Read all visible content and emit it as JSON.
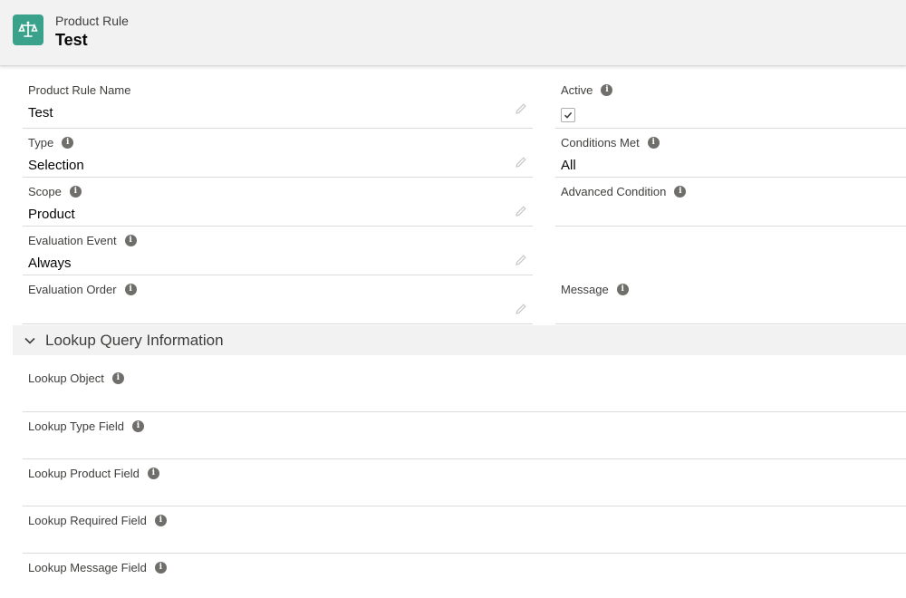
{
  "header": {
    "object_type": "Product Rule",
    "record_name": "Test",
    "icon": "scales-icon",
    "icon_color": "#3aa28a"
  },
  "fields": {
    "product_rule_name": {
      "label": "Product Rule Name",
      "value": "Test"
    },
    "type": {
      "label": "Type",
      "value": "Selection"
    },
    "scope": {
      "label": "Scope",
      "value": "Product"
    },
    "evaluation_event": {
      "label": "Evaluation Event",
      "value": "Always"
    },
    "evaluation_order": {
      "label": "Evaluation Order",
      "value": ""
    },
    "active": {
      "label": "Active",
      "checked": true
    },
    "conditions_met": {
      "label": "Conditions Met",
      "value": "All"
    },
    "advanced_condition": {
      "label": "Advanced Condition",
      "value": ""
    },
    "message": {
      "label": "Message",
      "value": ""
    }
  },
  "lookup_section": {
    "title": "Lookup Query Information",
    "fields": {
      "lookup_object": {
        "label": "Lookup Object",
        "value": ""
      },
      "lookup_type_field": {
        "label": "Lookup Type Field",
        "value": ""
      },
      "lookup_product_field": {
        "label": "Lookup Product Field",
        "value": ""
      },
      "lookup_required_field": {
        "label": "Lookup Required Field",
        "value": ""
      },
      "lookup_message_field": {
        "label": "Lookup Message Field",
        "value": ""
      }
    }
  },
  "icons": {
    "info": "info-icon",
    "edit": "pencil-icon",
    "collapse": "chevron-down-icon"
  }
}
